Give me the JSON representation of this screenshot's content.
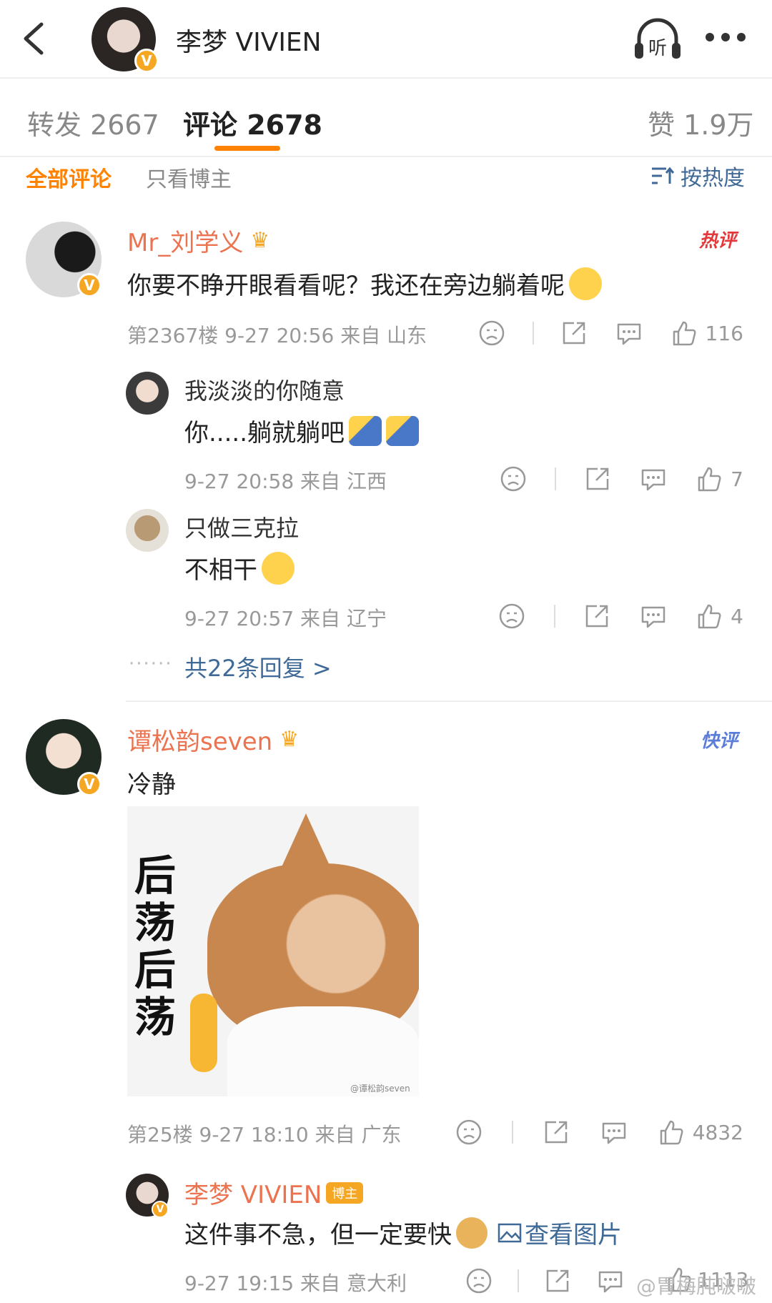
{
  "header": {
    "title": "李梦 VIVIEN",
    "listen_label": "听"
  },
  "tabs": {
    "repost": "转发 2667",
    "comments": "评论 2678",
    "likes": "赞 1.9万"
  },
  "filter": {
    "all": "全部评论",
    "owner_only": "只看博主",
    "sort": "按热度"
  },
  "comments": [
    {
      "name": "Mr_刘学义",
      "tag": "热评",
      "text": "你要不睁开眼看看呢？我还在旁边躺着呢",
      "meta": "第2367楼  9-27 20:56  来自 山东",
      "likes": "116",
      "replies": [
        {
          "name": "我淡淡的你随意",
          "text": "你.....躺就躺吧",
          "meta": "9-27 20:58  来自 江西",
          "likes": "7"
        },
        {
          "name": "只做三克拉",
          "text": "不相干",
          "meta": "9-27 20:57  来自 辽宁",
          "likes": "4"
        }
      ],
      "more_replies": "共22条回复 >"
    },
    {
      "name": "谭松韵seven",
      "tag": "快评",
      "text": "冷静",
      "sticker_text": [
        "后",
        "荡",
        "后",
        "荡"
      ],
      "sticker_watermark": "@谭松韵seven",
      "meta": "第25楼  9-27 18:10  来自 广东",
      "likes": "4832",
      "replies": [
        {
          "name": "李梦 VIVIEN",
          "badge": "博主",
          "text": "这件事不急，但一定要快",
          "link": "查看图片",
          "meta": "9-27 19:15  来自 意大利",
          "likes": "1113"
        }
      ]
    }
  ],
  "watermark": "@胃梅肫啵啵",
  "colors": {
    "accent": "#ff8200",
    "name": "#eb7350",
    "link": "#3f6a97",
    "verified": "#f5a623"
  }
}
